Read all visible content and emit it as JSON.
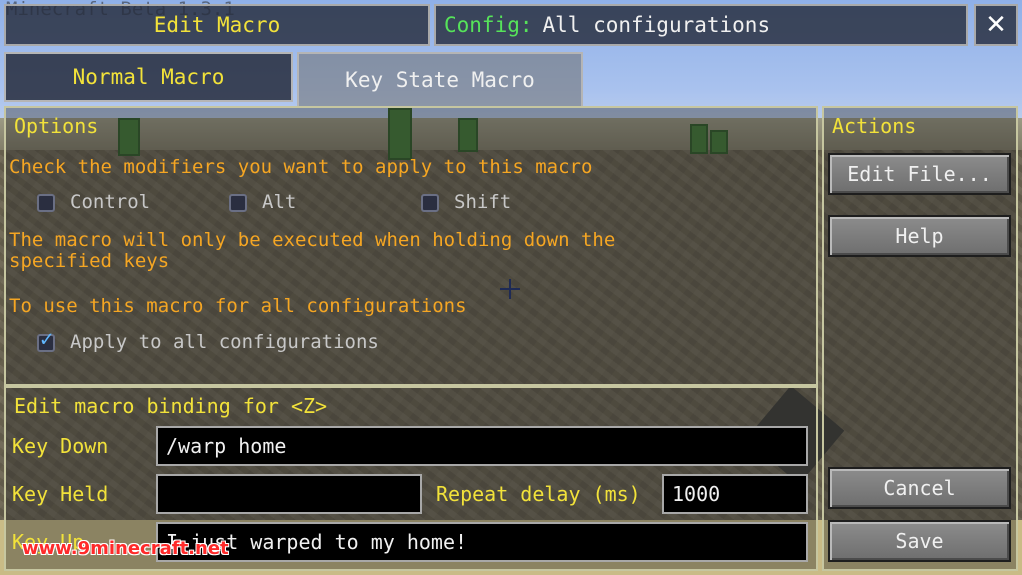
{
  "corner_text": "Minecraft Beta 1.3.1",
  "header": {
    "title": "Edit Macro",
    "config_label": "Config:",
    "config_value": "All configurations",
    "close_glyph": "✕"
  },
  "tabs": [
    {
      "label": "Normal Macro",
      "active": false
    },
    {
      "label": "Key State Macro",
      "active": true
    }
  ],
  "options": {
    "heading": "Options",
    "modifiers_prompt": "Check the modifiers you want to apply to this macro",
    "modifiers": [
      {
        "label": "Control",
        "checked": false
      },
      {
        "label": "Alt",
        "checked": false
      },
      {
        "label": "Shift",
        "checked": false
      }
    ],
    "note_line1": "The macro will only be executed when holding down the",
    "note_line2": "specified keys",
    "all_config_prompt": "To use this macro for all configurations",
    "apply_all_label": "Apply to all configurations",
    "apply_all_checked": true
  },
  "binding": {
    "heading": "Edit macro binding for <Z>",
    "key_down_label": "Key Down",
    "key_down_value": "/warp home",
    "key_held_label": "Key Held",
    "key_held_value": "",
    "repeat_delay_label": "Repeat delay (ms)",
    "repeat_delay_value": "1000",
    "key_up_label": "Key Up",
    "key_up_value": "I just warped to my home!"
  },
  "actions": {
    "heading": "Actions",
    "edit_file": "Edit File...",
    "help": "Help",
    "cancel": "Cancel",
    "save": "Save"
  },
  "watermark": "www.9minecraft.net",
  "colors": {
    "heading_yellow": "#f2e23a",
    "config_green": "#56e35a",
    "text_orange": "#f5a623",
    "watermark_red": "#ff2a2a"
  }
}
